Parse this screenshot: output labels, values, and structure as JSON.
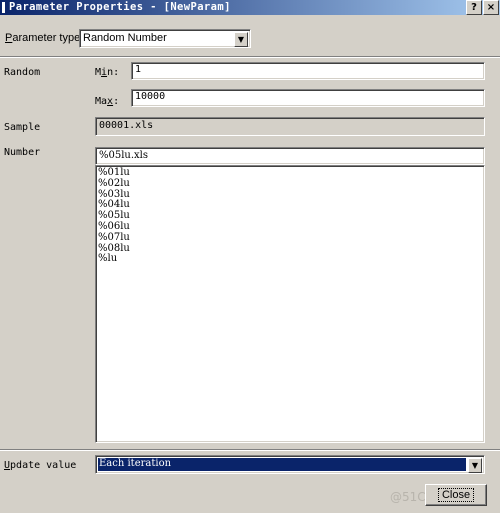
{
  "window": {
    "title": "Parameter Properties - [NewParam]",
    "help_glyph": "?",
    "close_glyph": "×"
  },
  "parameter_type": {
    "label_key": "P",
    "label_rest": "arameter type:",
    "value": "Random Number"
  },
  "random": {
    "label": "Random",
    "min_label_pre": "M",
    "min_label_key": "i",
    "min_label_post": "n:",
    "min_value": "1",
    "max_label_pre": "Ma",
    "max_label_key": "x",
    "max_label_post": ":",
    "max_value": "10000"
  },
  "sample": {
    "label": "Sample",
    "value": "00001.xls"
  },
  "number": {
    "label": "Number",
    "value": "%05lu.xls",
    "formats": [
      "%01lu",
      "%02lu",
      "%03lu",
      "%04lu",
      "%05lu",
      "%06lu",
      "%07lu",
      "%08lu",
      "%lu"
    ]
  },
  "update_value": {
    "label_key": "U",
    "label_rest": "pdate value",
    "value": "Each iteration"
  },
  "buttons": {
    "close": "Close"
  },
  "watermark": "@51CTO博客"
}
